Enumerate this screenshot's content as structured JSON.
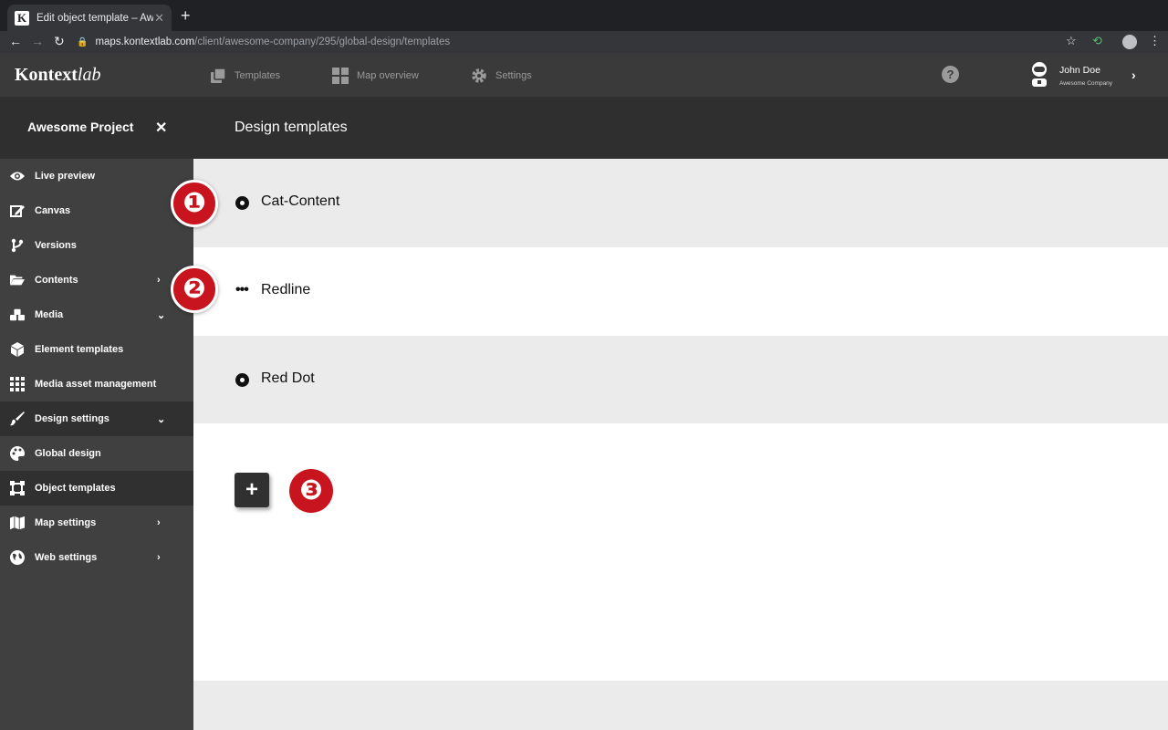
{
  "browser": {
    "tab_title": "Edit object template – Awesome",
    "tab_favicon": "K",
    "tab_close": "✕",
    "new_tab": "+",
    "url_host": "maps.kontextlab.com",
    "url_path": "/client/awesome-company/295/global-design/templates"
  },
  "app": {
    "logo_main": "Kontext",
    "logo_italic": "lab",
    "nav": [
      {
        "label": "Templates",
        "icon": "templates-icon"
      },
      {
        "label": "Map overview",
        "icon": "grid-icon"
      },
      {
        "label": "Settings",
        "icon": "gear-icon"
      }
    ],
    "help": "?",
    "user_name": "John Doe",
    "user_company": "Awesome Company"
  },
  "subheader": {
    "project_title": "Awesome Project",
    "close": "✕",
    "page_title": "Design templates"
  },
  "sidebar": {
    "items": [
      {
        "label": "Live preview",
        "icon": "eye-icon",
        "chevron": ""
      },
      {
        "label": "Canvas",
        "icon": "edit-icon",
        "chevron": ""
      },
      {
        "label": "Versions",
        "icon": "branch-icon",
        "chevron": ""
      },
      {
        "label": "Contents",
        "icon": "folder-icon",
        "chevron": "›"
      },
      {
        "label": "Media",
        "icon": "cubes-icon",
        "chevron": "⌄"
      },
      {
        "label": "Element templates",
        "icon": "box-icon",
        "chevron": ""
      },
      {
        "label": "Media asset management",
        "icon": "grid-icon",
        "chevron": ""
      },
      {
        "label": "Design settings",
        "icon": "brush-icon",
        "chevron": "⌄"
      },
      {
        "label": "Global design",
        "icon": "palette-icon",
        "chevron": ""
      },
      {
        "label": "Object templates",
        "icon": "object-icon",
        "chevron": ""
      },
      {
        "label": "Map settings",
        "icon": "map-icon",
        "chevron": "›"
      },
      {
        "label": "Web settings",
        "icon": "globe-icon",
        "chevron": "›"
      }
    ]
  },
  "templates": [
    {
      "label": "Cat-Content",
      "icon": "radio-dot-icon"
    },
    {
      "label": "Redline",
      "icon": "ellipsis-icon"
    },
    {
      "label": "Red Dot",
      "icon": "radio-dot-icon"
    }
  ],
  "add_button": "+",
  "callouts": [
    "❶",
    "❷",
    "❸"
  ],
  "colors": {
    "accent_red": "#c8141e",
    "appbar": "#3a3a3a",
    "sidebar": "#404040"
  }
}
